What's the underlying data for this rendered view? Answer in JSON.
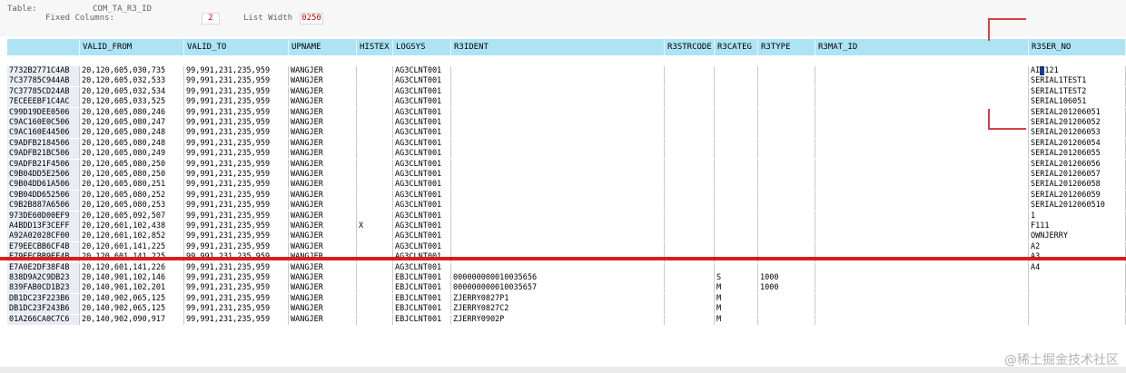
{
  "header": {
    "table_label": "Table:",
    "table_name": "COM_TA_R3_ID",
    "fixed_columns_label": "Fixed Columns:",
    "fixed_columns_value": "2",
    "list_width_label": "List Width",
    "list_width_value": "0250"
  },
  "columns": [
    "",
    "VALID_FROM",
    "VALID_TO",
    "UPNAME",
    "HISTEX",
    "LOGSYS",
    "R3IDENT",
    "R3STRCODE",
    "R3CATEG",
    "R3TYPE",
    "R3MAT_ID",
    "R3SER_NO"
  ],
  "rows": [
    [
      "7732B2771C4AB",
      "20,120,605,030,735",
      "99,991,231,235,959",
      "WANGJER",
      "",
      "AG3CLNT001",
      "",
      "",
      "",
      "",
      "",
      "AI_121"
    ],
    [
      "7C37785C944AB",
      "20,120,605,032,533",
      "99,991,231,235,959",
      "WANGJER",
      "",
      "AG3CLNT001",
      "",
      "",
      "",
      "",
      "",
      "SERIAL1TEST1"
    ],
    [
      "7C37785CD24AB",
      "20,120,605,032,534",
      "99,991,231,235,959",
      "WANGJER",
      "",
      "AG3CLNT001",
      "",
      "",
      "",
      "",
      "",
      "SERIAL1TEST2"
    ],
    [
      "7ECEEEBF1C4AC",
      "20,120,605,033,525",
      "99,991,231,235,959",
      "WANGJER",
      "",
      "AG3CLNT001",
      "",
      "",
      "",
      "",
      "",
      "SERIAL106051"
    ],
    [
      "C99D19DEE0506",
      "20,120,605,080,246",
      "99,991,231,235,959",
      "WANGJER",
      "",
      "AG3CLNT001",
      "",
      "",
      "",
      "",
      "",
      "SERIAL201206051"
    ],
    [
      "C9AC160E0C506",
      "20,120,605,080,247",
      "99,991,231,235,959",
      "WANGJER",
      "",
      "AG3CLNT001",
      "",
      "",
      "",
      "",
      "",
      "SERIAL201206052"
    ],
    [
      "C9AC160E44506",
      "20,120,605,080,248",
      "99,991,231,235,959",
      "WANGJER",
      "",
      "AG3CLNT001",
      "",
      "",
      "",
      "",
      "",
      "SERIAL201206053"
    ],
    [
      "C9ADFB2184506",
      "20,120,605,080,248",
      "99,991,231,235,959",
      "WANGJER",
      "",
      "AG3CLNT001",
      "",
      "",
      "",
      "",
      "",
      "SERIAL201206054"
    ],
    [
      "C9ADFB21BC506",
      "20,120,605,080,249",
      "99,991,231,235,959",
      "WANGJER",
      "",
      "AG3CLNT001",
      "",
      "",
      "",
      "",
      "",
      "SERIAL201206055"
    ],
    [
      "C9ADFB21F4506",
      "20,120,605,080,250",
      "99,991,231,235,959",
      "WANGJER",
      "",
      "AG3CLNT001",
      "",
      "",
      "",
      "",
      "",
      "SERIAL201206056"
    ],
    [
      "C9B04DD5E2506",
      "20,120,605,080,250",
      "99,991,231,235,959",
      "WANGJER",
      "",
      "AG3CLNT001",
      "",
      "",
      "",
      "",
      "",
      "SERIAL201206057"
    ],
    [
      "C9B04DD61A506",
      "20,120,605,080,251",
      "99,991,231,235,959",
      "WANGJER",
      "",
      "AG3CLNT001",
      "",
      "",
      "",
      "",
      "",
      "SERIAL201206058"
    ],
    [
      "C9B04DD652506",
      "20,120,605,080,252",
      "99,991,231,235,959",
      "WANGJER",
      "",
      "AG3CLNT001",
      "",
      "",
      "",
      "",
      "",
      "SERIAL201206059"
    ],
    [
      "C9B2B887A6506",
      "20,120,605,080,253",
      "99,991,231,235,959",
      "WANGJER",
      "",
      "AG3CLNT001",
      "",
      "",
      "",
      "",
      "",
      "SERIAL2012060510"
    ],
    [
      "973DE60D00EF9",
      "20,120,605,092,507",
      "99,991,231,235,959",
      "WANGJER",
      "",
      "AG3CLNT001",
      "",
      "",
      "",
      "",
      "",
      "1"
    ],
    [
      "A4BDD13F3CEFF",
      "20,120,601,102,438",
      "99,991,231,235,959",
      "WANGJER",
      "X",
      "AG3CLNT001",
      "",
      "",
      "",
      "",
      "",
      "F111"
    ],
    [
      "A92A02028CF00",
      "20,120,601,102,852",
      "99,991,231,235,959",
      "WANGJER",
      "",
      "AG3CLNT001",
      "",
      "",
      "",
      "",
      "",
      "OWNJERRY"
    ],
    [
      "E79EECBB6CF4B",
      "20,120,601,141,225",
      "99,991,231,235,959",
      "WANGJER",
      "",
      "AG3CLNT001",
      "",
      "",
      "",
      "",
      "",
      "A2"
    ],
    [
      "E79EECBB9EF4B",
      "20,120,601,141,225",
      "99,991,231,235,959",
      "WANGJER",
      "",
      "AG3CLNT001",
      "",
      "",
      "",
      "",
      "",
      "A3"
    ],
    [
      "E7A0E2DF38F4B",
      "20,120,601,141,226",
      "99,991,231,235,959",
      "WANGJER",
      "",
      "AG3CLNT001",
      "",
      "",
      "",
      "",
      "",
      "A4"
    ],
    [
      "838D9A2C9DB23",
      "20,140,901,102,146",
      "99,991,231,235,959",
      "WANGJER",
      "",
      "EBJCLNT001",
      "000000000010035656",
      "",
      "S",
      "1000",
      "",
      ""
    ],
    [
      "839FAB0CD1B23",
      "20,140,901,102,201",
      "99,991,231,235,959",
      "WANGJER",
      "",
      "EBJCLNT001",
      "000000000010035657",
      "",
      "M",
      "1000",
      "",
      ""
    ],
    [
      "DB1DC23F223B6",
      "20,140,902,065,125",
      "99,991,231,235,959",
      "WANGJER",
      "",
      "EBJCLNT001",
      "ZJERRY0827P1",
      "",
      "M",
      "",
      "",
      ""
    ],
    [
      "DB1DC23F243B6",
      "20,140,902,065,125",
      "99,991,231,235,959",
      "WANGJER",
      "",
      "EBJCLNT001",
      "ZJERRY0827C2",
      "",
      "M",
      "",
      "",
      ""
    ],
    [
      "01A266CA0C7C6",
      "20,140,902,090,917",
      "99,991,231,235,959",
      "WANGJER",
      "",
      "EBJCLNT001",
      "ZJERRY0902P",
      "",
      "M",
      "",
      "",
      ""
    ]
  ],
  "watermark": "@稀土掘金技术社区",
  "colors": {
    "header_bg": "#aee3f6",
    "key_bg": "#e8edf3",
    "marker_red": "#d71d1d"
  }
}
